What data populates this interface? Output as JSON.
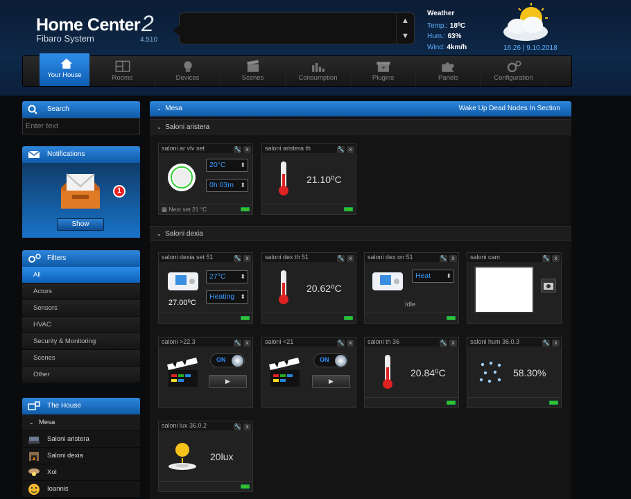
{
  "header": {
    "title": "Home Center",
    "title_num": "2",
    "subtitle": "Fibaro System",
    "version": "4.510"
  },
  "weather": {
    "title": "Weather",
    "temp_label": "Temp.:",
    "temp": "18⁰C",
    "hum_label": "Hum.:",
    "hum": "63%",
    "wind_label": "Wind:",
    "wind": "4km/h",
    "datetime": "16:26 | 9.10.2018"
  },
  "nav": [
    {
      "label": "Your House",
      "icon": "house-icon"
    },
    {
      "label": "Rooms",
      "icon": "rooms-icon"
    },
    {
      "label": "Devices",
      "icon": "bulb-icon"
    },
    {
      "label": "Scenes",
      "icon": "clapper-icon"
    },
    {
      "label": "Consumption",
      "icon": "chart-icon"
    },
    {
      "label": "Plugins",
      "icon": "box-icon"
    },
    {
      "label": "Panels",
      "icon": "puzzle-icon"
    },
    {
      "label": "Configuration",
      "icon": "gear-icon"
    }
  ],
  "search": {
    "title": "Search",
    "placeholder": "Enter text"
  },
  "notifications": {
    "title": "Notifications",
    "count": "1",
    "show_label": "Show"
  },
  "filters": {
    "title": "Filters",
    "items": [
      "All",
      "Actors",
      "Sensors",
      "HVAC",
      "Security & Monitoring",
      "Scenes",
      "Other"
    ]
  },
  "house": {
    "title": "The House",
    "section": "Mesa",
    "items": [
      "Saloni aristera",
      "Saloni dexia",
      "Xol",
      "Ioannis"
    ]
  },
  "main": {
    "title": "Mesa",
    "action": "Wake Up Dead Nodes In Section",
    "sections": [
      "Saloni aristera",
      "Saloni dexia"
    ]
  },
  "devices": {
    "d1": {
      "name": "saloni ar vlv set",
      "temp": "20°C",
      "time": "0h:03m",
      "footer": "Next set 21 °C"
    },
    "d2": {
      "name": "saloni aristera th",
      "value": "21.10⁰C"
    },
    "d3": {
      "name": "saloni dexia set 51",
      "temp": "27°C",
      "mode": "Heating",
      "value": "27.00⁰C"
    },
    "d4": {
      "name": "saloni dex th 51",
      "value": "20.62⁰C"
    },
    "d5": {
      "name": "saloni dex on 51",
      "mode": "Heat",
      "state": "Idle"
    },
    "d6": {
      "name": "saloni cam"
    },
    "d7": {
      "name": "saloni >22.3",
      "toggle": "ON"
    },
    "d8": {
      "name": "saloni <21",
      "toggle": "ON"
    },
    "d9": {
      "name": "saloni th 36",
      "value": "20.84⁰C"
    },
    "d10": {
      "name": "saloni hum 36.0.3",
      "value": "58.30%"
    },
    "d11": {
      "name": "saloni lux 36.0.2",
      "value": "20lux"
    }
  },
  "colors": {
    "accent": "#1a74d2",
    "led": "#36c02a",
    "value_blue": "#3a9bff"
  }
}
